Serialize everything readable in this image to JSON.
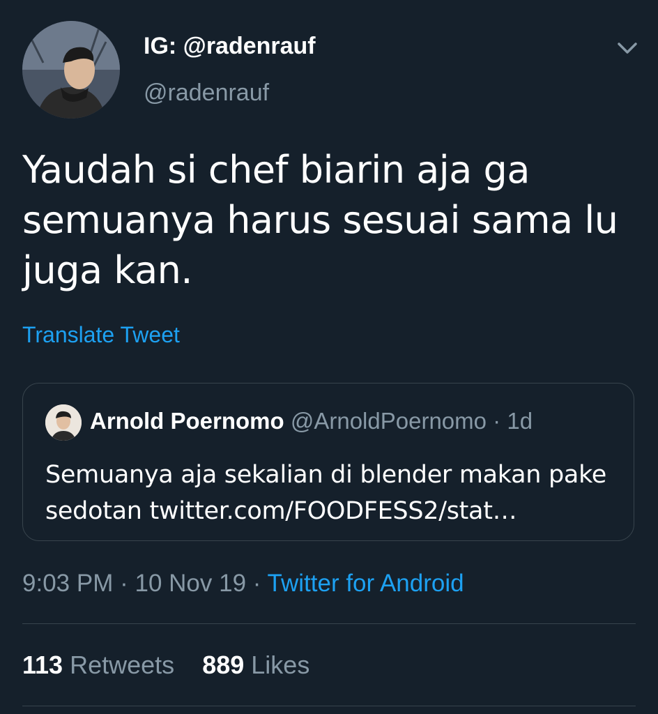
{
  "author": {
    "display_name": "IG: @radenrauf",
    "handle": "@radenrauf",
    "avatar_icon": "user-avatar"
  },
  "menu": {
    "icon": "chevron-down-icon"
  },
  "tweet": {
    "text": "Yaudah si chef biarin aja ga semuanya harus sesuai sama lu juga kan.",
    "translate_label": "Translate Tweet"
  },
  "quoted": {
    "display_name": "Arnold Poernomo",
    "handle": "@ArnoldPoernomo",
    "separator": "·",
    "time": "1d",
    "text": "Semuanya aja sekalian di blender makan pake sedotan twitter.com/FOODFESS2/stat…"
  },
  "meta": {
    "time": "9:03 PM",
    "sep1": "·",
    "date": "10 Nov 19",
    "sep2": "·",
    "source": "Twitter for Android"
  },
  "stats": {
    "retweets_count": "113",
    "retweets_label": "Retweets",
    "likes_count": "889",
    "likes_label": "Likes"
  },
  "colors": {
    "background": "#15202b",
    "text": "#ffffff",
    "secondary": "#8899a6",
    "accent": "#1da1f2",
    "border": "#38444d"
  }
}
